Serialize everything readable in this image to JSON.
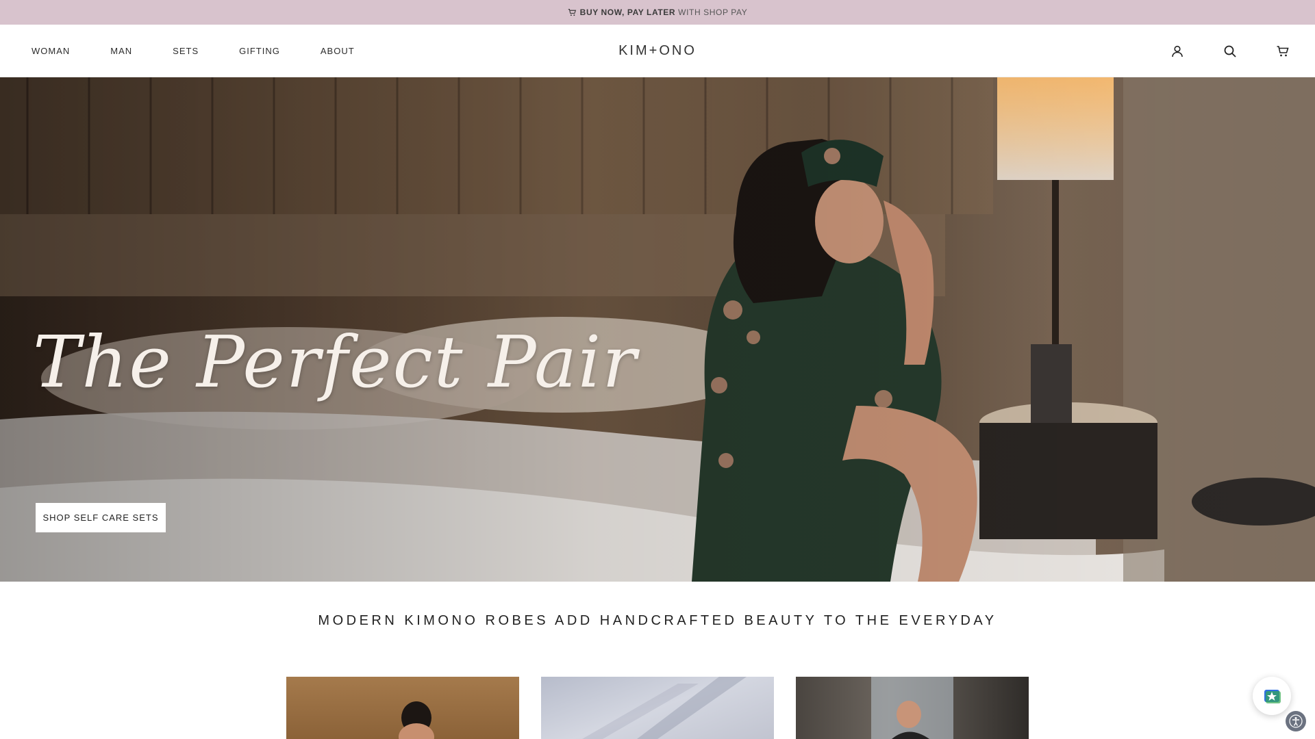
{
  "announcement": {
    "icon": "shopping-cart-icon",
    "bold_text": "BUY NOW, PAY LATER",
    "light_text": "WITH SHOP PAY",
    "background_color": "#d8c3cd"
  },
  "header": {
    "nav": [
      "WOMAN",
      "MAN",
      "SETS",
      "GIFTING",
      "ABOUT"
    ],
    "logo": "KIM+ONO",
    "icons": [
      "account-icon",
      "search-icon",
      "cart-icon"
    ]
  },
  "hero": {
    "title": "The Perfect Pair",
    "button_label": "SHOP SELF CARE SETS"
  },
  "tagline": "MODERN KIMONO ROBES ADD HANDCRAFTED BEAUTY TO THE EVERYDAY",
  "tiles": [
    "product-tile-1",
    "product-tile-2",
    "product-tile-3"
  ],
  "widgets": {
    "reviews_badge": "reviews-badge-icon",
    "accessibility": "accessibility-icon"
  }
}
